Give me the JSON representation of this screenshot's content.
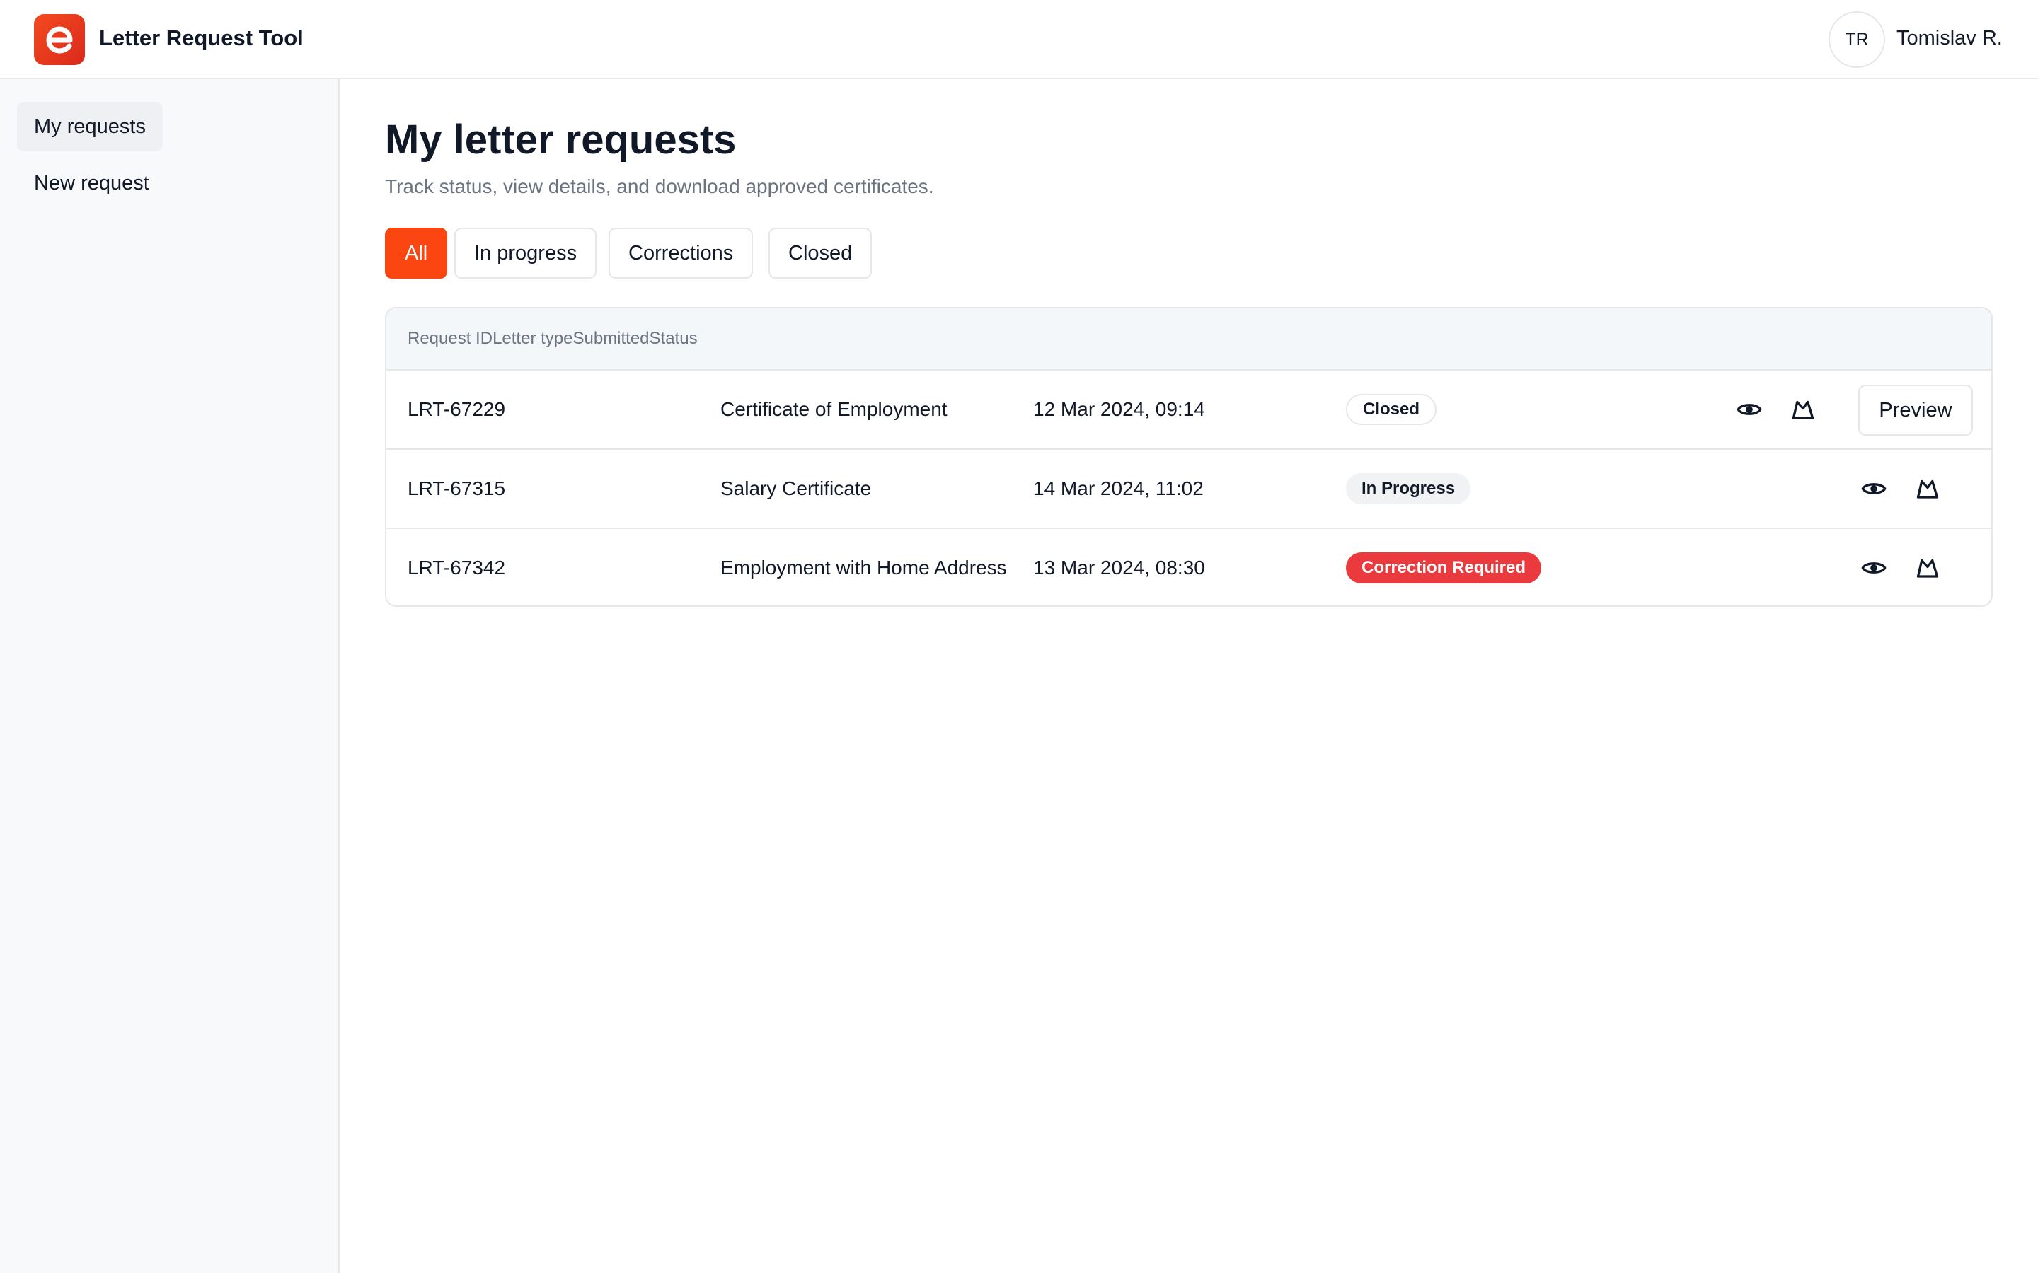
{
  "app": {
    "title": "Letter Request Tool",
    "user_initials": "TR",
    "user_name": "Tomislav R.",
    "accent_color": "#fb4611"
  },
  "sidebar": {
    "items": [
      {
        "label": "My requests",
        "active": true
      },
      {
        "label": "New request",
        "active": false
      }
    ]
  },
  "main": {
    "title": "My letter requests",
    "subtitle": "Track status, view details, and download approved certificates.",
    "tabs": [
      {
        "label": "All",
        "active": true
      },
      {
        "label": "In progress",
        "active": false
      },
      {
        "label": "Corrections",
        "active": false
      },
      {
        "label": "Closed",
        "active": false
      }
    ]
  },
  "table": {
    "headers": [
      "Request ID",
      "Letter type",
      "Submitted",
      "Status"
    ],
    "rows": [
      {
        "id": "LRT-67229",
        "type": "Certificate of Employment",
        "submitted": "12 Mar 2024, 09:14",
        "status": "Closed",
        "status_kind": "closed",
        "actions": [
          "eye-icon",
          "download-icon"
        ],
        "preview_label": "Preview"
      },
      {
        "id": "LRT-67315",
        "type": "Salary Certificate",
        "submitted": "14 Mar 2024, 11:02",
        "status": "In Progress",
        "status_kind": "progress",
        "actions": [
          "eye-icon",
          "download-icon"
        ]
      },
      {
        "id": "LRT-67342",
        "type": "Employment with Home Address",
        "submitted": "13 Mar 2024, 08:30",
        "status": "Correction Required",
        "status_kind": "correction",
        "actions": [
          "eye-icon",
          "download-icon"
        ]
      }
    ]
  }
}
